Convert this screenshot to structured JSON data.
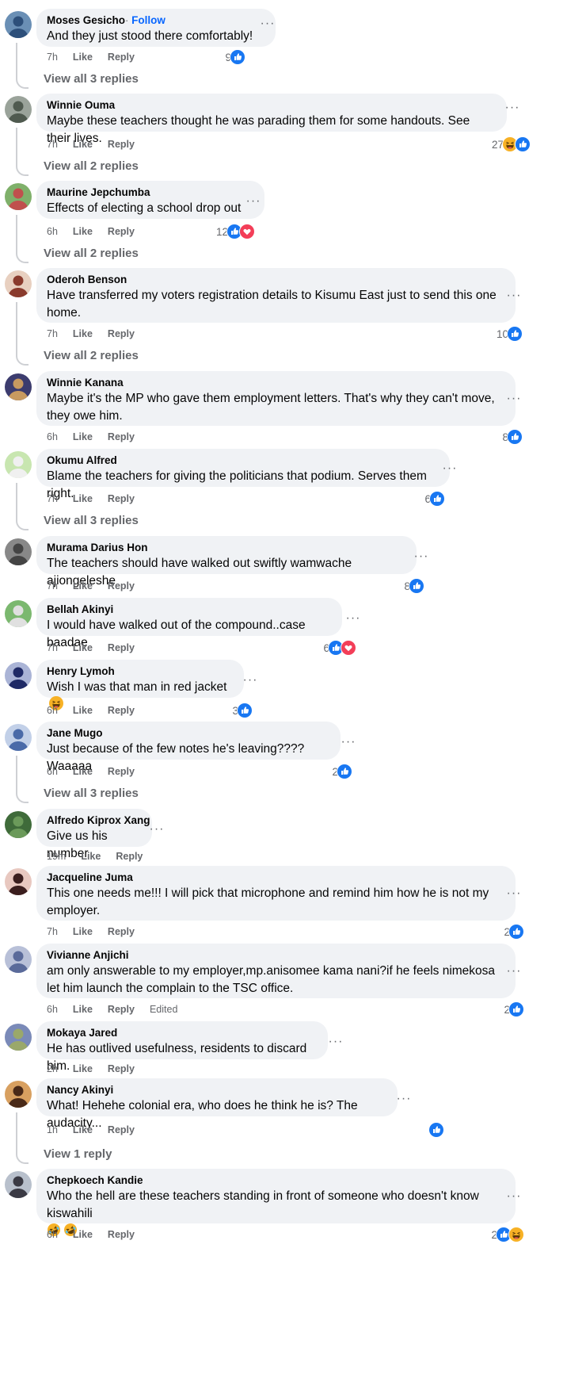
{
  "comments": [
    {
      "author": "Moses Gesicho",
      "follow": "Follow",
      "follow_sep": "·",
      "text": "And they just stood there comfortably!",
      "time": "7h",
      "like": "Like",
      "reply": "Reply",
      "count": "9",
      "reactions": [
        "like"
      ],
      "view_replies": "View all 3 replies"
    },
    {
      "author": "Winnie Ouma",
      "text": "Maybe these teachers thought he was parading them for some handouts. See their lives.",
      "time": "7h",
      "like": "Like",
      "reply": "Reply",
      "count": "27",
      "reactions": [
        "haha",
        "like"
      ],
      "view_replies": "View all 2 replies"
    },
    {
      "author": "Maurine Jepchumba",
      "text": "Effects of electing a school drop out",
      "time": "6h",
      "like": "Like",
      "reply": "Reply",
      "count": "12",
      "reactions": [
        "like",
        "love"
      ],
      "view_replies": "View all 2 replies"
    },
    {
      "author": "Oderoh Benson",
      "text": "Have transferred my voters registration details to Kisumu East just to send this one home.",
      "time": "7h",
      "like": "Like",
      "reply": "Reply",
      "count": "10",
      "reactions": [
        "like"
      ],
      "view_replies": "View all 2 replies"
    },
    {
      "author": "Winnie Kanana",
      "text": "Maybe it's the MP who gave them employment letters. That's why they can't move, they owe him.",
      "time": "6h",
      "like": "Like",
      "reply": "Reply",
      "count": "8",
      "reactions": [
        "like"
      ]
    },
    {
      "author": "Okumu Alfred",
      "text": "Blame the teachers for giving the politicians that podium. Serves them right.",
      "time": "7h",
      "like": "Like",
      "reply": "Reply",
      "count": "6",
      "reactions": [
        "like"
      ],
      "view_replies": "View all 3 replies"
    },
    {
      "author": "Murama Darius Hon",
      "text": "The teachers should have walked out swiftly wamwache ajiongeleshe",
      "time": "7h",
      "like": "Like",
      "reply": "Reply",
      "count": "8",
      "reactions": [
        "like"
      ]
    },
    {
      "author": "Bellah Akinyi",
      "text": "I would have walked out of the compound..case baadae",
      "time": "7h",
      "like": "Like",
      "reply": "Reply",
      "count": "6",
      "reactions": [
        "like",
        "love"
      ]
    },
    {
      "author": "Henry Lymoh",
      "text": "Wish I was that man in red jacket",
      "text_emoji": "laugh",
      "time": "6h",
      "like": "Like",
      "reply": "Reply",
      "count": "3",
      "reactions": [
        "like"
      ]
    },
    {
      "author": "Jane Mugo",
      "text": "Just because of the few notes he's leaving???? Waaaaa",
      "time": "6h",
      "like": "Like",
      "reply": "Reply",
      "count": "2",
      "reactions": [
        "like"
      ],
      "view_replies": "View all 3 replies"
    },
    {
      "author": "Alfredo Kiprox Xang",
      "text": "Give us his number",
      "time": "19m",
      "like": "Like",
      "reply": "Reply",
      "count": "",
      "reactions": []
    },
    {
      "author": "Jacqueline Juma",
      "text": "This one needs me!!! I will pick that microphone and remind him how he is not my employer.",
      "time": "7h",
      "like": "Like",
      "reply": "Reply",
      "count": "2",
      "reactions": [
        "like"
      ]
    },
    {
      "author": "Vivianne Anjichi",
      "text": "am only answerable to my employer,mp.anisomee kama nani?if he feels nimekosa let him launch the complain to the TSC office.",
      "time": "6h",
      "like": "Like",
      "reply": "Reply",
      "edited": "Edited",
      "count": "2",
      "reactions": [
        "like"
      ]
    },
    {
      "author": "Mokaya Jared",
      "text": "He has outlived usefulness, residents to discard him.",
      "time": "2h",
      "like": "Like",
      "reply": "Reply",
      "count": "",
      "reactions": []
    },
    {
      "author": "Nancy Akinyi",
      "text": "What! Hehehe colonial era, who does he think he is? The audacity...",
      "time": "1h",
      "like": "Like",
      "reply": "Reply",
      "count": "",
      "reactions": [
        "like"
      ],
      "view_replies": "View 1 reply"
    },
    {
      "author": "Chepkoech Kandie",
      "text": "Who the hell are these teachers standing in front of someone who doesn't know kiswahili",
      "text_emoji2": "rofl",
      "time": "6h",
      "like": "Like",
      "reply": "Reply",
      "count": "2",
      "reactions": [
        "like",
        "haha"
      ]
    }
  ],
  "colors": {
    "like": "#1877f2",
    "love": "#f33e58",
    "haha": "#f7b125",
    "bubble": "#f0f2f5",
    "meta": "#65676b",
    "link": "#0866ff"
  }
}
